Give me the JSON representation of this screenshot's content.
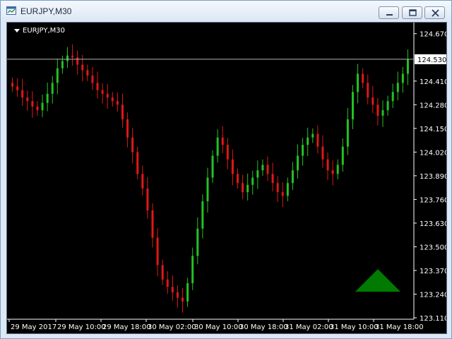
{
  "window": {
    "title": "EURJPY,M30"
  },
  "chart": {
    "symbol_label": "EURJPY,M30",
    "current_price": "124.530"
  },
  "colors": {
    "background": "#000000",
    "bull": "#22c322",
    "bear": "#e01818",
    "axis": "#ffffff",
    "bid_line": "#b4b4b4",
    "arrow": "#007a00"
  },
  "icons": {
    "window_min": "minimize-icon",
    "window_max": "maximize-icon",
    "window_close": "close-icon",
    "app": "chart-window-icon",
    "arrow": "up-triangle-icon"
  },
  "chart_data": {
    "type": "candlestick",
    "title": "EURJPY,M30",
    "ylim": [
      123.11,
      124.7
    ],
    "y_ticks": [
      "124.670",
      "124.410",
      "124.280",
      "124.150",
      "124.020",
      "123.890",
      "123.760",
      "123.630",
      "123.500",
      "123.370",
      "123.240",
      "123.110"
    ],
    "x_ticks": [
      "29 May 2017",
      "29 May 10:00",
      "29 May 18:00",
      "30 May 02:00",
      "30 May 10:00",
      "30 May 18:00",
      "31 May 02:00",
      "31 May 10:00",
      "31 May 18:00"
    ],
    "bid_price": 124.53,
    "close_series": [
      124.38,
      124.36,
      124.32,
      124.3,
      124.27,
      124.25,
      124.29,
      124.34,
      124.4,
      124.48,
      124.52,
      124.55,
      124.54,
      124.5,
      124.47,
      124.44,
      124.4,
      124.36,
      124.34,
      124.32,
      124.3,
      124.28,
      124.2,
      124.1,
      124.02,
      123.9,
      123.82,
      123.7,
      123.55,
      123.4,
      123.32,
      123.28,
      123.25,
      123.22,
      123.2,
      123.3,
      123.45,
      123.6,
      123.75,
      123.88,
      124.0,
      124.1,
      124.06,
      123.98,
      123.9,
      123.85,
      123.8,
      123.84,
      123.88,
      123.92,
      123.95,
      123.9,
      123.85,
      123.8,
      123.78,
      123.85,
      123.92,
      124.0,
      124.06,
      124.1,
      124.12,
      124.05,
      123.98,
      123.92,
      123.9,
      123.95,
      124.05,
      124.2,
      124.35,
      124.45,
      124.4,
      124.32,
      124.28,
      124.22,
      124.25,
      124.3,
      124.35,
      124.4,
      124.45,
      124.53
    ]
  }
}
